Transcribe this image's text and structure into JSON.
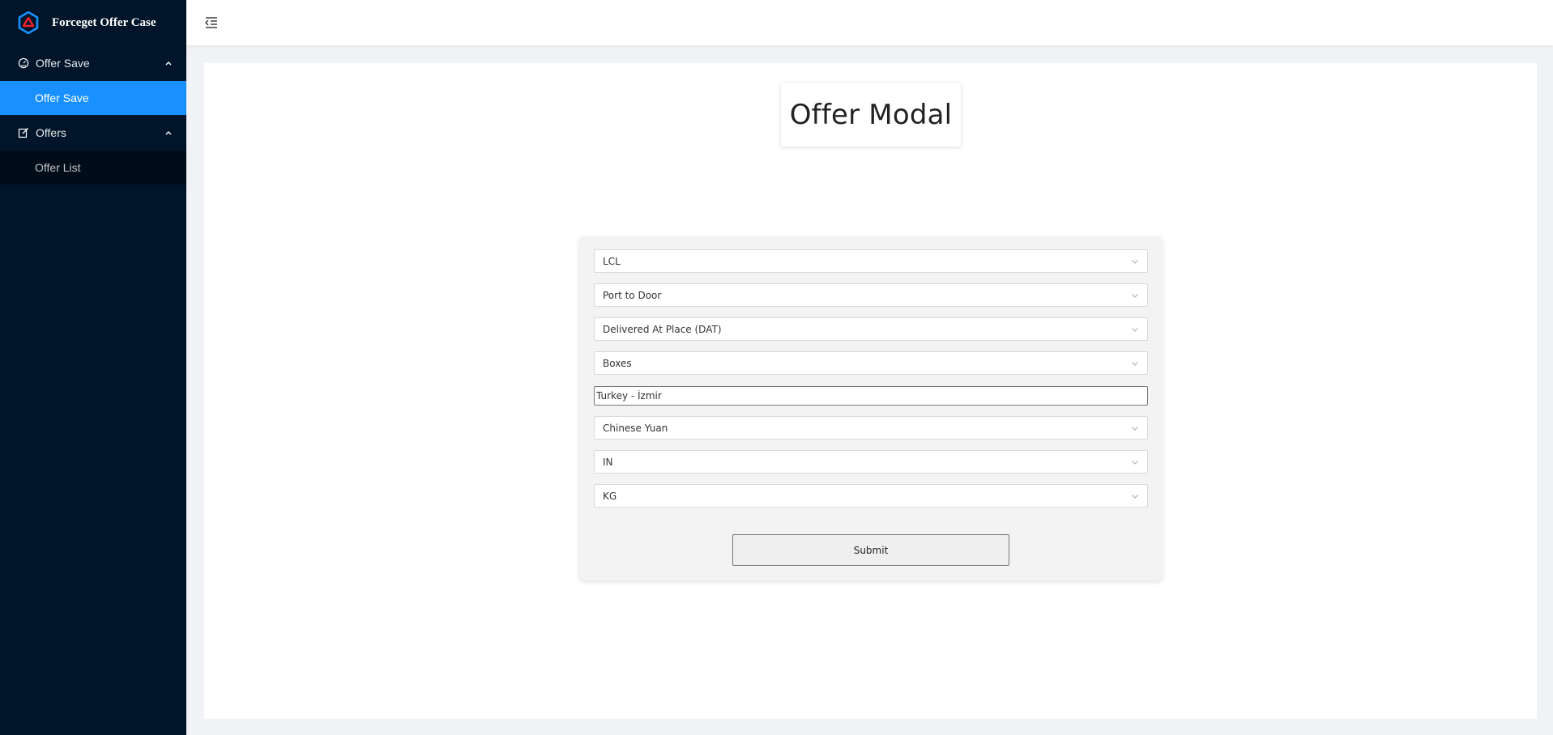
{
  "sidebar": {
    "brand": {
      "title": "Forceget Offer Case",
      "logo": "hexagon-logo-icon"
    },
    "groups": [
      {
        "label": "Offer Save",
        "icon": "dashboard-icon",
        "expanded": true,
        "items": [
          {
            "label": "Offer Save",
            "active": true
          }
        ]
      },
      {
        "label": "Offers",
        "icon": "edit-icon",
        "expanded": true,
        "items": [
          {
            "label": "Offer List",
            "active": false
          }
        ]
      }
    ]
  },
  "header": {
    "toggle_icon": "menu-fold-icon"
  },
  "main": {
    "title": "Offer Modal",
    "form": {
      "mode": "LCL",
      "movement_type": "Port to Door",
      "incoterm": "Delivered At Place (DAT)",
      "package_type": "Boxes",
      "location": "Turkey - İzmir",
      "currency": "Chinese Yuan",
      "dimension_unit": "IN",
      "weight_unit": "KG",
      "submit_label": "Submit"
    }
  },
  "colors": {
    "sidebar_bg": "#001529",
    "submenu_bg": "#000c17",
    "active_item": "#1890ff",
    "logo_blue": "#1890ff",
    "logo_red": "#f5222d"
  }
}
